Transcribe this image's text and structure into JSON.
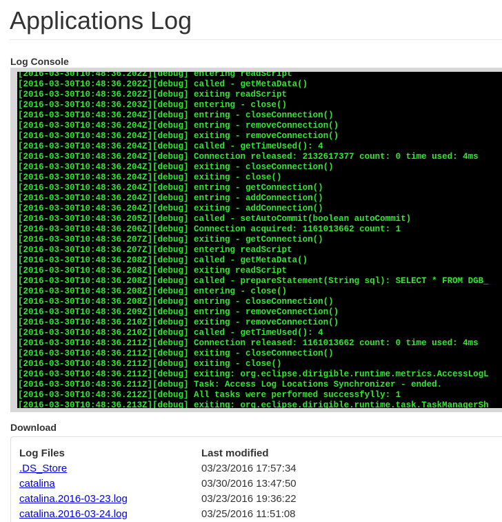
{
  "page": {
    "title": "Applications Log"
  },
  "console": {
    "label": "Log Console",
    "lines": [
      "[2016-03-30T10:48:36.202Z][debug] entering readScript",
      "[2016-03-30T10:48:36.202Z][debug] called - getMetaData()",
      "[2016-03-30T10:48:36.202Z][debug] exiting readScript",
      "[2016-03-30T10:48:36.203Z][debug] entering - close()",
      "[2016-03-30T10:48:36.204Z][debug] entring - closeConnection()",
      "[2016-03-30T10:48:36.204Z][debug] entring - removeConnection()",
      "[2016-03-30T10:48:36.204Z][debug] exiting - removeConnection()",
      "[2016-03-30T10:48:36.204Z][debug] called - getTimeUsed(): 4",
      "[2016-03-30T10:48:36.204Z][debug] Connection released: 2132617377 count: 0 time used: 4ms",
      "[2016-03-30T10:48:36.204Z][debug] exiting - closeConnection()",
      "[2016-03-30T10:48:36.204Z][debug] exiting - close()",
      "[2016-03-30T10:48:36.204Z][debug] entring - getConnection()",
      "[2016-03-30T10:48:36.204Z][debug] entring - addConnection()",
      "[2016-03-30T10:48:36.204Z][debug] exiting - addConnection()",
      "[2016-03-30T10:48:36.205Z][debug] called - setAutoCommit(boolean autoCommit)",
      "[2016-03-30T10:48:36.206Z][debug] Connection acquired: 1161013662 count: 1",
      "[2016-03-30T10:48:36.207Z][debug] exiting - getConnection()",
      "[2016-03-30T10:48:36.207Z][debug] entering readScript",
      "[2016-03-30T10:48:36.208Z][debug] called - getMetaData()",
      "[2016-03-30T10:48:36.208Z][debug] exiting readScript",
      "[2016-03-30T10:48:36.208Z][debug] called - prepareStatement(String sql): SELECT * FROM DGB_",
      "[2016-03-30T10:48:36.208Z][debug] entering - close()",
      "[2016-03-30T10:48:36.208Z][debug] entring - closeConnection()",
      "[2016-03-30T10:48:36.209Z][debug] entring - removeConnection()",
      "[2016-03-30T10:48:36.210Z][debug] exiting - removeConnection()",
      "[2016-03-30T10:48:36.210Z][debug] called - getTimeUsed(): 4",
      "[2016-03-30T10:48:36.211Z][debug] Connection released: 1161013662 count: 0 time used: 4ms",
      "[2016-03-30T10:48:36.211Z][debug] exiting - closeConnection()",
      "[2016-03-30T10:48:36.211Z][debug] exiting - close()",
      "[2016-03-30T10:48:36.211Z][debug] exiting: org.eclipse.dirigible.runtime.metrics.AccessLogL",
      "[2016-03-30T10:48:36.211Z][debug] Task: Access Log Locations Synchronizer - ended.",
      "[2016-03-30T10:48:36.212Z][debug] All tasks were performed successfylly: 1",
      "[2016-03-30T10:48:36.213Z][debug] exiting: org.eclipse.dirigible.runtime.task.TaskManagerSh"
    ],
    "text_color": "#33e633",
    "background_color": "#000000"
  },
  "download": {
    "label": "Download",
    "headers": {
      "name": "Log Files",
      "modified": "Last modified"
    },
    "files": [
      {
        "name": ".DS_Store",
        "modified": "03/23/2016 17:57:34"
      },
      {
        "name": "catalina",
        "modified": "03/30/2016 13:47:50"
      },
      {
        "name": "catalina.2016-03-23.log",
        "modified": "03/23/2016 19:36:22"
      },
      {
        "name": "catalina.2016-03-24.log",
        "modified": "03/25/2016 11:51:08"
      }
    ],
    "link_color": "#0000ee"
  }
}
